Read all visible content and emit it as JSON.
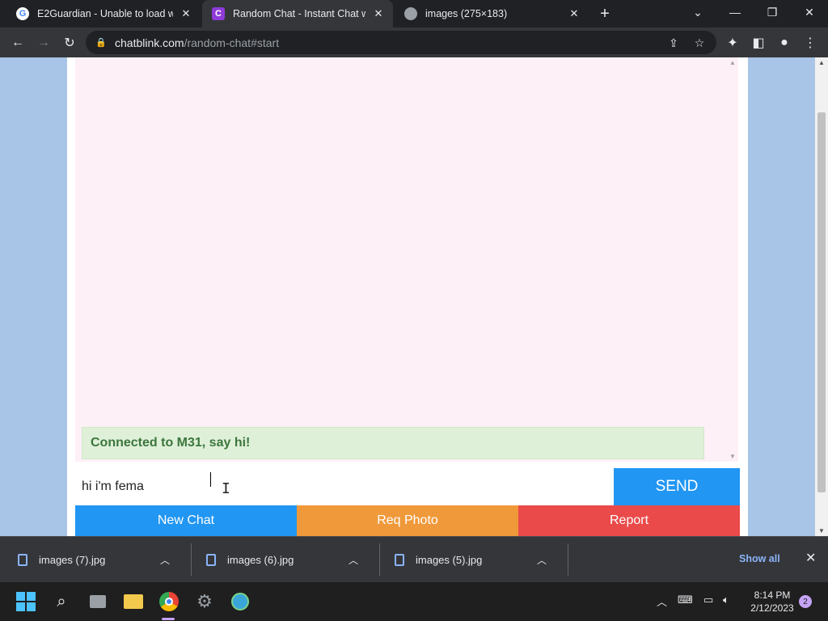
{
  "browser": {
    "tabs": [
      {
        "title": "E2Guardian - Unable to load web",
        "favicon": "google-icon",
        "active": false
      },
      {
        "title": "Random Chat - Instant Chat with",
        "favicon": "chatblink-icon",
        "active": true
      },
      {
        "title": "images (275×183)",
        "favicon": "globe-icon",
        "active": false
      }
    ],
    "url_host": "chatblink.com",
    "url_path": "/random-chat#start"
  },
  "chat": {
    "status_message": "Connected to M31, say hi!",
    "input_value": "hi i'm fema",
    "send_label": "SEND",
    "new_chat_label": "New Chat",
    "req_photo_label": "Req Photo",
    "report_label": "Report",
    "colors": {
      "blue": "#2196f3",
      "orange": "#f0993a",
      "red": "#ea4a4a",
      "status_bg": "#dff0d8",
      "status_text": "#3c763d"
    }
  },
  "downloads": {
    "items": [
      {
        "name": "images (7).jpg"
      },
      {
        "name": "images (6).jpg"
      },
      {
        "name": "images (5).jpg"
      }
    ],
    "show_all_label": "Show all"
  },
  "taskbar": {
    "time": "8:14 PM",
    "date": "2/12/2023",
    "notification_count": "2"
  }
}
